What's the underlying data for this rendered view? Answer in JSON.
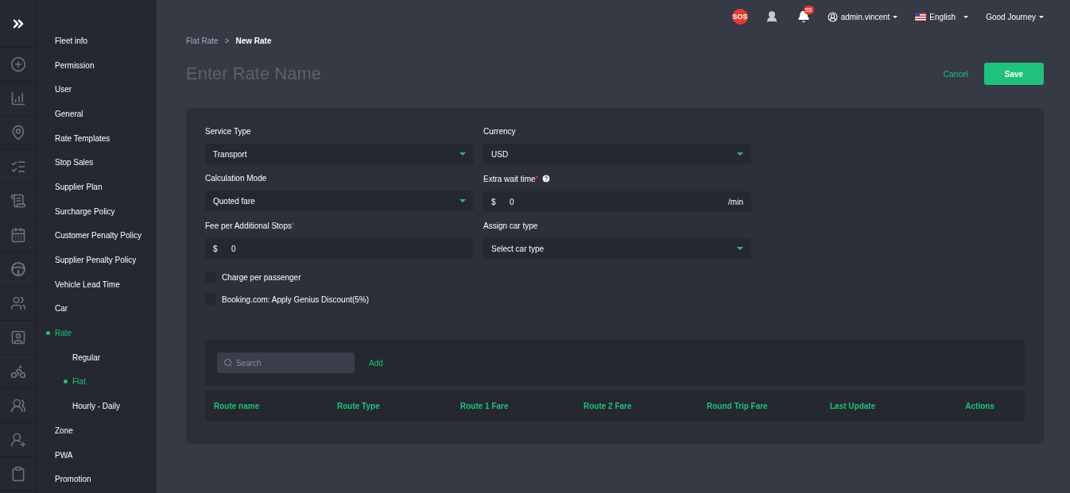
{
  "sidebar": {
    "items": [
      {
        "label": "Fleet info",
        "selected": false
      },
      {
        "label": "Permission",
        "selected": false
      },
      {
        "label": "User",
        "selected": false
      },
      {
        "label": "General",
        "selected": false
      },
      {
        "label": "Rate Templates",
        "selected": false
      },
      {
        "label": "Stop Sales",
        "selected": false
      },
      {
        "label": "Supplier Plan",
        "selected": false
      },
      {
        "label": "Surcharge Policy",
        "selected": false
      },
      {
        "label": "Customer Penalty Policy",
        "selected": false
      },
      {
        "label": "Supplier Penalty Policy",
        "selected": false
      },
      {
        "label": "Vehicle Lead Time",
        "selected": false
      },
      {
        "label": "Car",
        "selected": false
      },
      {
        "label": "Rate",
        "selected": true,
        "children": [
          {
            "label": "Regular",
            "selected": false
          },
          {
            "label": "Flat",
            "selected": true
          },
          {
            "label": "Hourly - Daily",
            "selected": false
          }
        ]
      },
      {
        "label": "Zone",
        "selected": false
      },
      {
        "label": "PWA",
        "selected": false
      },
      {
        "label": "Promotion",
        "selected": false
      }
    ]
  },
  "topbar": {
    "sos": "SOS",
    "notifications": "55",
    "user": "admin.vincent",
    "language": "English",
    "company": "Good Journey"
  },
  "breadcrumb": {
    "items": [
      "Flat Rate",
      "New Rate"
    ],
    "separator": ">"
  },
  "rate_name": {
    "placeholder": "Enter Rate Name"
  },
  "actions": {
    "cancel": "Cancel",
    "save": "Save"
  },
  "form": {
    "fields": [
      {
        "kind": "select",
        "label": "Service Type",
        "value": "Transport"
      },
      {
        "kind": "select",
        "label": "Currency",
        "value": "USD"
      },
      {
        "kind": "select",
        "label": "Calculation Mode",
        "value": "Quoted fare"
      },
      {
        "kind": "money",
        "label": "Extra wait time",
        "required_mark": "*",
        "help": true,
        "prefix": "$",
        "value": "0",
        "suffix": "/min"
      },
      {
        "kind": "money",
        "label": "Fee per Additional Stops",
        "required_mark": "*",
        "prefix": "$",
        "value": "0"
      },
      {
        "kind": "select",
        "label": "Assign car type",
        "value": "Select car type"
      }
    ],
    "checkboxes": [
      {
        "label": "Charge per passenger",
        "checked": false
      },
      {
        "label": "Booking.com: Apply Genius Discount(5%)",
        "checked": false
      }
    ]
  },
  "routes": {
    "search": {
      "placeholder": "Search"
    },
    "add": "Add",
    "columns": [
      "Route name",
      "Route Type",
      "Route 1 Fare",
      "Route 2 Fare",
      "Round Trip Fare",
      "Last Update",
      "Actions"
    ]
  }
}
